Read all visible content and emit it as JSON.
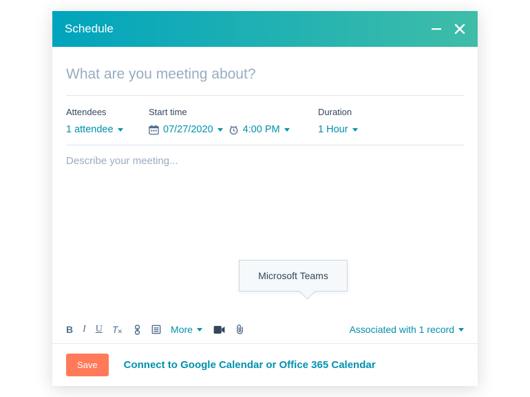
{
  "header": {
    "title": "Schedule"
  },
  "subject": {
    "placeholder": "What are you meeting about?"
  },
  "fields": {
    "attendees": {
      "label": "Attendees",
      "value": "1 attendee"
    },
    "start": {
      "label": "Start time",
      "date": "07/27/2020",
      "time": "4:00 PM"
    },
    "duration": {
      "label": "Duration",
      "value": "1 Hour"
    }
  },
  "description": {
    "placeholder": "Describe your meeting..."
  },
  "tooltip": {
    "text": "Microsoft Teams"
  },
  "toolbar": {
    "more_label": "More",
    "associated_label": "Associated with 1 record"
  },
  "footer": {
    "save_label": "Save",
    "connect_label": "Connect to Google Calendar or Office 365 Calendar"
  }
}
